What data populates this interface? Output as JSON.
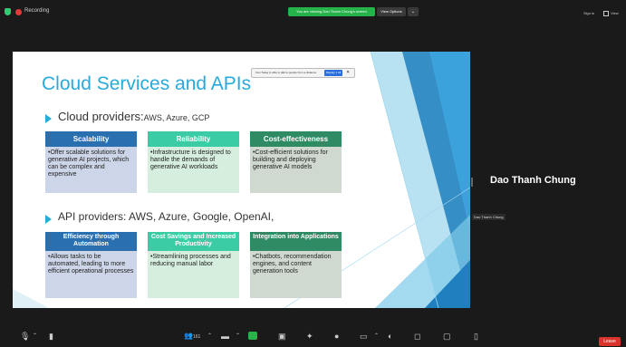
{
  "topbar": {
    "recording_label": "Recording",
    "share_banner": "You are viewing Dao Thanh Chung's screen",
    "view_options": "View Options",
    "view_options_caret": "⌄",
    "sign_in": "Sign in",
    "view": "View"
  },
  "slide": {
    "title": "Cloud Services and APIs",
    "cloud_line_main": "Cloud providers:",
    "cloud_line_small": "AWS, Azure, GCP",
    "api_line": "API providers: AWS, Azure, Google, OpenAI,",
    "cloud_columns": [
      {
        "header": "Scalability",
        "body": "•Offer scalable solutions for generative AI projects, which can be complex and expensive"
      },
      {
        "header": "Reliability",
        "body": "•Infrastructure is designed to handle the demands of generative AI workloads"
      },
      {
        "header": "Cost-effectiveness",
        "body": "•Cost-efficient solutions for building and deploying generative AI models"
      }
    ],
    "api_columns": [
      {
        "header": "Efficiency through Automation",
        "body": "•Allows tasks to be automated, leading to more efficient operational processes"
      },
      {
        "header": "Cost Savings and Increased Productivity",
        "body": "•Streamlining processes and reducing manual labor"
      },
      {
        "header": "Integration into Applications",
        "body": "•Chatbots, recommendation engines, and content generation tools"
      }
    ],
    "ppt_toolbar_text": "Can Today is able to talk to people from a distance",
    "ppt_toolbar_button": "Display 1 All"
  },
  "speaker": {
    "name": "Dao Thanh Chung",
    "tag": "Dao Thanh Chung"
  },
  "bottombar": {
    "participants_count": "161",
    "leave": "Leave"
  },
  "colors": {
    "title_blue": "#29aadc",
    "header_blue": "#2a6fb0",
    "header_teal": "#3ccca5",
    "header_green": "#2e8b64",
    "leave_red": "#d8342c",
    "banner_green": "#25b34a"
  }
}
